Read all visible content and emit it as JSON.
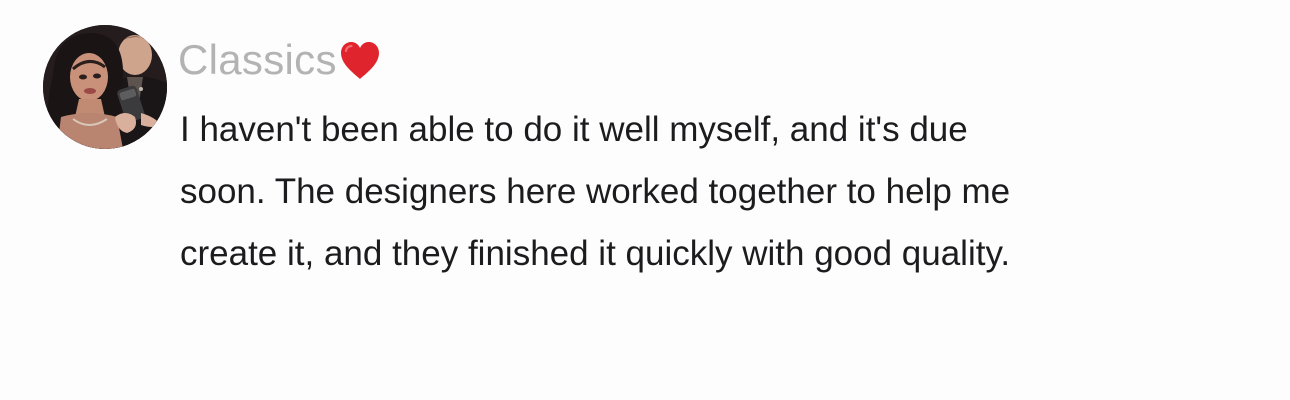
{
  "comment": {
    "username": "Classics",
    "username_icon": "red-heart-icon",
    "text": "I haven't been able to do it well myself, and it's due soon. The designers here worked together to help me create it, and they finished it quickly with good quality."
  },
  "colors": {
    "username": "#b3b3b3",
    "text": "#1c1c1e",
    "heart": "#e0242e",
    "background": "#fdfdfd"
  }
}
